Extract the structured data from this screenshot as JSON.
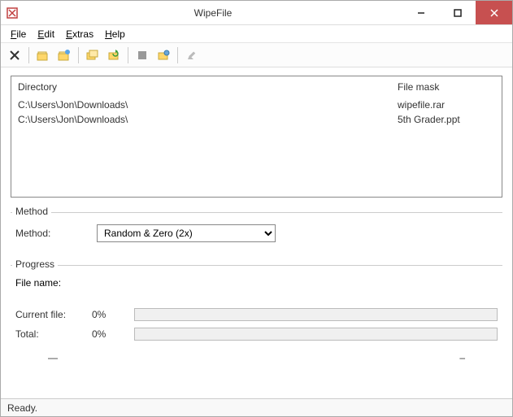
{
  "title": "WipeFile",
  "menu": {
    "file": "File",
    "edit": "Edit",
    "extras": "Extras",
    "help": "Help"
  },
  "filelist": {
    "header_dir": "Directory",
    "header_mask": "File mask",
    "rows": [
      {
        "dir": "C:\\Users\\Jon\\Downloads\\",
        "mask": "wipefile.rar"
      },
      {
        "dir": "C:\\Users\\Jon\\Downloads\\",
        "mask": "5th Grader.ppt"
      }
    ]
  },
  "method": {
    "group_title": "Method",
    "label": "Method:",
    "selected": "Random & Zero (2x)"
  },
  "progress": {
    "group_title": "Progress",
    "filename_label": "File name:",
    "filename_value": "",
    "current_label": "Current file:",
    "current_pct": "0%",
    "total_label": "Total:",
    "total_pct": "0%",
    "dash_left": "—",
    "dash_right": "–"
  },
  "status": "Ready."
}
